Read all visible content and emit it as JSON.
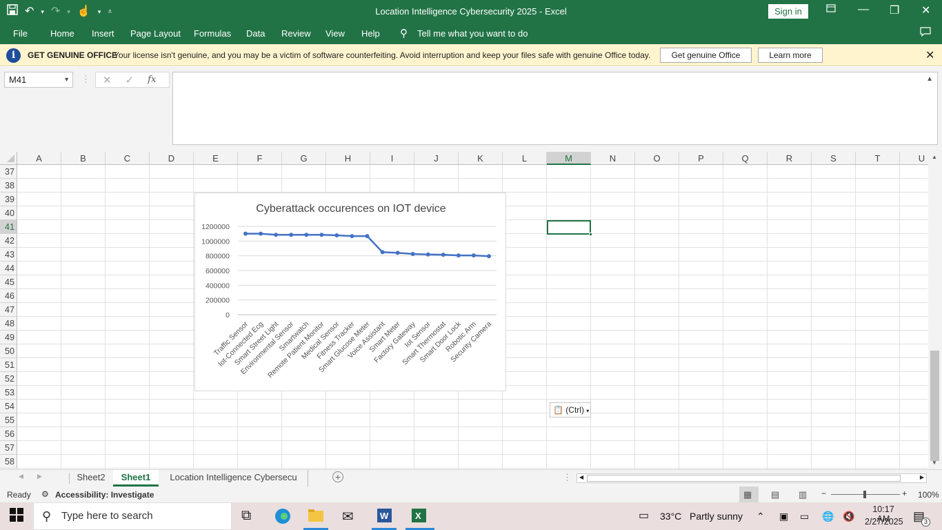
{
  "window": {
    "title": "Location Intelligence Cybersecurity 2025  -  Excel",
    "sign_in": "Sign in"
  },
  "ribbon": {
    "tabs": [
      "File",
      "Home",
      "Insert",
      "Page Layout",
      "Formulas",
      "Data",
      "Review",
      "View",
      "Help",
      "Tell me what you want to do"
    ]
  },
  "message_bar": {
    "heading": "GET GENUINE OFFICE",
    "text": "Your license isn't genuine, and you may be a victim of software counterfeiting. Avoid interruption and keep your files safe with genuine Office today.",
    "primary_button": "Get genuine Office",
    "secondary_button": "Learn more"
  },
  "formula_bar": {
    "name_box": "M41",
    "fx": "fx",
    "value": ""
  },
  "grid": {
    "columns": [
      "A",
      "B",
      "C",
      "D",
      "E",
      "F",
      "G",
      "H",
      "I",
      "J",
      "K",
      "L",
      "M",
      "N",
      "O",
      "P",
      "Q",
      "R",
      "S",
      "T",
      "U"
    ],
    "rows": [
      "37",
      "38",
      "39",
      "40",
      "41",
      "42",
      "43",
      "44",
      "45",
      "46",
      "47",
      "48",
      "49",
      "50",
      "51",
      "52",
      "53",
      "54",
      "55",
      "56",
      "57",
      "58"
    ],
    "selected_column": "M",
    "selected_row": "41"
  },
  "chart_data": {
    "type": "line",
    "title": "Cyberattack occurences on IOT device",
    "categories": [
      "Traffic Sensor",
      "Iot-Connected Ecg",
      "Smart Street Light",
      "Environmental Sensor",
      "Smartwatch",
      "Remote Patient Monitor",
      "Medical Sensor",
      "Fitness Tracker",
      "Smart Glucose Meter",
      "Voice Assistant",
      "Smart Meter",
      "Factory Gateway",
      "Iot Sensor",
      "Smart Thermostat",
      "Smart Door Lock",
      "Robotic Arm",
      "Security Camera"
    ],
    "values": [
      1100000,
      1100000,
      1085000,
      1085000,
      1085000,
      1085000,
      1078000,
      1068000,
      1068000,
      850000,
      840000,
      825000,
      818000,
      815000,
      805000,
      805000,
      795000
    ],
    "ylim": [
      0,
      1200000
    ],
    "yticks": [
      "1200000",
      "1000000",
      "800000",
      "600000",
      "400000",
      "200000",
      "0"
    ],
    "xlabel": "",
    "ylabel": "",
    "grid": true,
    "color": "#4472c4"
  },
  "paste_options": {
    "label": "(Ctrl)"
  },
  "sheets": {
    "tabs": [
      "Sheet2",
      "Sheet1",
      "Location Intelligence Cybersecu"
    ],
    "active": "Sheet1"
  },
  "status": {
    "ready": "Ready",
    "accessibility": "Accessibility: Investigate",
    "zoom": "100%"
  },
  "taskbar": {
    "search_placeholder": "Type here to search",
    "weather_temp": "33°C",
    "weather_desc": "Partly sunny",
    "time": "10:17 AM",
    "date": "2/27/2025",
    "notifications": "3"
  },
  "colors": {
    "excel_green": "#217346",
    "message_bar": "#fff4ce"
  }
}
